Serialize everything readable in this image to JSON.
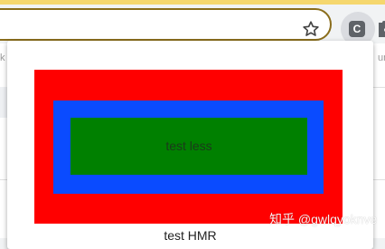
{
  "browser": {
    "extension_badge": "C",
    "icons": [
      "star-icon",
      "extension-icon",
      "puzzle-icon"
    ],
    "colors": {
      "accent_strip": "#f5d76e",
      "omnibox_border": "#8a6d1c"
    }
  },
  "background_page": {
    "tab_left_fragment": "k",
    "tab_right_fragment": "un"
  },
  "popup": {
    "inner_text": "test less",
    "footer_text": "test HMR",
    "colors": {
      "outer": "#ff0000",
      "middle": "#0a4bff",
      "inner": "#008000"
    }
  },
  "watermark": "知乎 @gwlqyoknve"
}
